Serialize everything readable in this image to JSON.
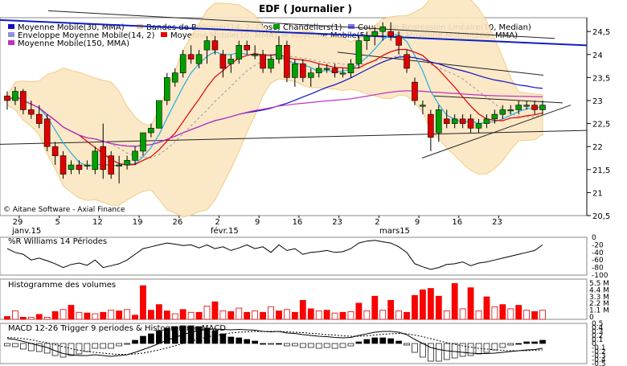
{
  "title": "EDF  ( Journalier )",
  "copyright": "© Aitane Software - Axial Finance",
  "legend": [
    {
      "label": "Moyenne Mobile(30, MMA)",
      "color": "#1010c0"
    },
    {
      "label": "Bandes de Bollinger(14, 2, Close)",
      "color": "#f5d08a"
    },
    {
      "label": "Chandeliers(1)",
      "color": "#00a000"
    },
    {
      "label": "Courbe de Regression Linéaire(10, Median)",
      "color": "#7070ff"
    },
    {
      "label": "Enveloppe Moyenne Mobile(14, 2)",
      "color": "#9090e0"
    },
    {
      "label": "Moyenne Mobile(10, MMA)",
      "color": "#e00000"
    },
    {
      "label": "Moyenne Mobile(5, MMA)",
      "color": "#20b0e0"
    },
    {
      "label": "Moyenne Mobile(200, MMA)",
      "color": "#6060c0"
    },
    {
      "label": "Moyenne Mobile(150, MMA)",
      "color": "#c030c0"
    }
  ],
  "x_axis": {
    "day_ticks": [
      "29",
      "5",
      "12",
      "19",
      "26",
      "2",
      "9",
      "16",
      "23",
      "2",
      "9",
      "16",
      "23"
    ],
    "month_labels": [
      "janv.15",
      "févr.15",
      "mars15"
    ]
  },
  "panels": {
    "williams_title": "%R Williams 14 Périodes",
    "volume_title": "Histogramme des volumes",
    "macd_title": "MACD 12-26   Trigger 9 periodes & Histogramme MACD"
  },
  "chart_data": {
    "type": "candlestick",
    "title": "EDF  ( Journalier )",
    "ylim": [
      20.5,
      24.8
    ],
    "y_ticks": [
      "24,5",
      "24",
      "23,5",
      "23",
      "22,5",
      "22",
      "21,5",
      "21",
      "20,5"
    ],
    "candles": [
      [
        23.1,
        23.2,
        22.8,
        23.0
      ],
      [
        23.0,
        23.3,
        22.9,
        23.2
      ],
      [
        23.2,
        23.25,
        22.7,
        22.8
      ],
      [
        22.8,
        23.0,
        22.6,
        22.7
      ],
      [
        22.7,
        22.9,
        22.4,
        22.5
      ],
      [
        22.6,
        22.7,
        21.9,
        22.0
      ],
      [
        22.0,
        22.1,
        21.6,
        21.8
      ],
      [
        21.8,
        21.9,
        21.3,
        21.4
      ],
      [
        21.5,
        21.7,
        21.4,
        21.6
      ],
      [
        21.6,
        21.7,
        21.4,
        21.5
      ],
      [
        21.6,
        21.7,
        21.5,
        21.6
      ],
      [
        21.5,
        22.0,
        21.4,
        21.9
      ],
      [
        22.0,
        22.5,
        21.3,
        21.5
      ],
      [
        21.8,
        21.9,
        21.3,
        21.4
      ],
      [
        21.6,
        21.8,
        21.2,
        21.6
      ],
      [
        21.6,
        21.8,
        21.5,
        21.7
      ],
      [
        21.7,
        22.0,
        21.6,
        21.9
      ],
      [
        21.9,
        22.3,
        21.8,
        22.3
      ],
      [
        22.3,
        22.5,
        22.2,
        22.4
      ],
      [
        22.4,
        23.0,
        22.4,
        23.0
      ],
      [
        23.0,
        23.6,
        22.9,
        23.5
      ],
      [
        23.4,
        23.7,
        23.3,
        23.6
      ],
      [
        23.6,
        24.1,
        23.5,
        24.0
      ],
      [
        24.0,
        24.2,
        23.8,
        23.9
      ],
      [
        23.8,
        24.1,
        23.7,
        24.0
      ],
      [
        24.1,
        24.4,
        23.8,
        24.3
      ],
      [
        24.3,
        24.4,
        24.0,
        24.1
      ],
      [
        24.0,
        24.1,
        23.5,
        23.7
      ],
      [
        23.8,
        24.0,
        23.6,
        23.9
      ],
      [
        23.9,
        24.3,
        23.8,
        24.2
      ],
      [
        24.2,
        24.3,
        24.0,
        24.1
      ],
      [
        24.0,
        24.2,
        23.9,
        24.0
      ],
      [
        24.0,
        24.1,
        23.6,
        23.7
      ],
      [
        23.7,
        24.0,
        23.6,
        23.9
      ],
      [
        23.9,
        24.4,
        23.8,
        24.2
      ],
      [
        24.2,
        24.3,
        23.4,
        23.5
      ],
      [
        23.5,
        23.9,
        23.3,
        23.8
      ],
      [
        23.8,
        23.9,
        23.4,
        23.5
      ],
      [
        23.5,
        23.7,
        23.3,
        23.6
      ],
      [
        23.6,
        23.8,
        23.5,
        23.7
      ],
      [
        23.7,
        23.8,
        23.6,
        23.7
      ],
      [
        23.7,
        23.8,
        23.5,
        23.6
      ],
      [
        23.6,
        23.7,
        23.5,
        23.6
      ],
      [
        23.6,
        23.9,
        23.5,
        23.8
      ],
      [
        23.8,
        24.4,
        23.7,
        24.3
      ],
      [
        24.3,
        24.5,
        24.1,
        24.4
      ],
      [
        24.4,
        24.6,
        24.2,
        24.5
      ],
      [
        24.5,
        24.7,
        24.3,
        24.6
      ],
      [
        24.5,
        24.7,
        24.3,
        24.4
      ],
      [
        24.4,
        24.5,
        24.0,
        24.2
      ],
      [
        24.0,
        24.1,
        23.6,
        23.7
      ],
      [
        23.4,
        23.5,
        22.9,
        23.0
      ],
      [
        22.9,
        23.0,
        22.7,
        22.9
      ],
      [
        22.7,
        22.8,
        21.9,
        22.2
      ],
      [
        22.3,
        22.9,
        22.1,
        22.8
      ],
      [
        22.6,
        22.8,
        22.4,
        22.5
      ],
      [
        22.5,
        22.7,
        22.4,
        22.6
      ],
      [
        22.6,
        22.7,
        22.4,
        22.5
      ],
      [
        22.6,
        22.7,
        22.3,
        22.4
      ],
      [
        22.4,
        22.6,
        22.3,
        22.5
      ],
      [
        22.5,
        22.7,
        22.4,
        22.6
      ],
      [
        22.6,
        22.8,
        22.5,
        22.7
      ],
      [
        22.7,
        22.9,
        22.6,
        22.8
      ],
      [
        22.8,
        22.9,
        22.7,
        22.8
      ],
      [
        22.8,
        23.0,
        22.7,
        22.9
      ],
      [
        22.9,
        23.0,
        22.8,
        22.9
      ],
      [
        22.9,
        23.0,
        22.7,
        22.8
      ],
      [
        22.8,
        23.0,
        22.7,
        22.9
      ]
    ],
    "williams": [
      -30,
      -40,
      -45,
      -60,
      -55,
      -62,
      -70,
      -80,
      -72,
      -68,
      -74,
      -60,
      -80,
      -75,
      -70,
      -60,
      -45,
      -30,
      -25,
      -20,
      -15,
      -18,
      -22,
      -20,
      -28,
      -20,
      -30,
      -25,
      -35,
      -28,
      -20,
      -30,
      -25,
      -40,
      -20,
      -35,
      -30,
      -45,
      -40,
      -38,
      -35,
      -40,
      -38,
      -30,
      -15,
      -10,
      -8,
      -12,
      -15,
      -25,
      -40,
      -70,
      -78,
      -85,
      -80,
      -72,
      -70,
      -65,
      -75,
      -68,
      -65,
      -60,
      -55,
      -50,
      -45,
      -40,
      -35,
      -20
    ],
    "williams_ticks": [
      "0",
      "-20",
      "-40",
      "-60",
      "-80",
      "-100"
    ],
    "volume": [
      0.4,
      1.2,
      0.3,
      0.3,
      0.7,
      0.3,
      1.1,
      1.4,
      2.0,
      1.0,
      0.9,
      0.8,
      1.0,
      1.3,
      1.2,
      1.4,
      0.6,
      4.8,
      1.3,
      2.1,
      1.2,
      0.8,
      1.4,
      1.0,
      1.0,
      1.9,
      2.5,
      1.2,
      1.1,
      1.6,
      1.0,
      1.2,
      1.0,
      1.8,
      1.2,
      1.4,
      1.0,
      2.7,
      1.5,
      1.2,
      1.3,
      0.9,
      1.0,
      1.1,
      2.3,
      1.2,
      3.3,
      1.3,
      2.7,
      1.2,
      1.0,
      3.4,
      4.2,
      4.4,
      3.3,
      1.2,
      5.1,
      1.5,
      4.5,
      1.2,
      3.2,
      1.8,
      2.1,
      1.5,
      2.0,
      1.3,
      1.1,
      1.3
    ],
    "volume_ticks": [
      "5.5 M",
      "4.4 M",
      "3.3 M",
      "2.2 M",
      "1.1 M",
      "0"
    ],
    "macd": [
      0.12,
      0.1,
      0.05,
      0.0,
      -0.05,
      -0.1,
      -0.18,
      -0.25,
      -0.28,
      -0.3,
      -0.3,
      -0.28,
      -0.3,
      -0.32,
      -0.3,
      -0.28,
      -0.22,
      -0.15,
      -0.08,
      0.0,
      0.08,
      0.15,
      0.22,
      0.28,
      0.32,
      0.35,
      0.36,
      0.35,
      0.34,
      0.35,
      0.34,
      0.33,
      0.3,
      0.29,
      0.3,
      0.26,
      0.25,
      0.22,
      0.2,
      0.18,
      0.17,
      0.15,
      0.14,
      0.15,
      0.2,
      0.24,
      0.28,
      0.3,
      0.3,
      0.28,
      0.22,
      0.1,
      0.0,
      -0.1,
      -0.15,
      -0.18,
      -0.2,
      -0.22,
      -0.24,
      -0.25,
      -0.25,
      -0.24,
      -0.22,
      -0.2,
      -0.18,
      -0.16,
      -0.15,
      -0.12
    ],
    "macd_trigger": [
      0.15,
      0.14,
      0.12,
      0.09,
      0.05,
      0.02,
      -0.03,
      -0.08,
      -0.13,
      -0.17,
      -0.2,
      -0.22,
      -0.24,
      -0.26,
      -0.27,
      -0.27,
      -0.26,
      -0.24,
      -0.2,
      -0.16,
      -0.11,
      -0.06,
      0.0,
      0.06,
      0.11,
      0.16,
      0.2,
      0.23,
      0.26,
      0.28,
      0.29,
      0.3,
      0.3,
      0.3,
      0.3,
      0.29,
      0.28,
      0.27,
      0.25,
      0.24,
      0.22,
      0.21,
      0.19,
      0.18,
      0.18,
      0.19,
      0.21,
      0.23,
      0.24,
      0.25,
      0.24,
      0.21,
      0.17,
      0.12,
      0.07,
      0.02,
      -0.02,
      -0.06,
      -0.09,
      -0.12,
      -0.14,
      -0.16,
      -0.17,
      -0.18,
      -0.18,
      -0.18,
      -0.17,
      -0.16
    ],
    "macd_ticks": [
      "0.5",
      "0.4",
      "0.3",
      "0.2",
      "0.1",
      "0",
      "-0.1",
      "-0.2",
      "-0.3",
      "-0.4",
      "-0.5"
    ]
  }
}
